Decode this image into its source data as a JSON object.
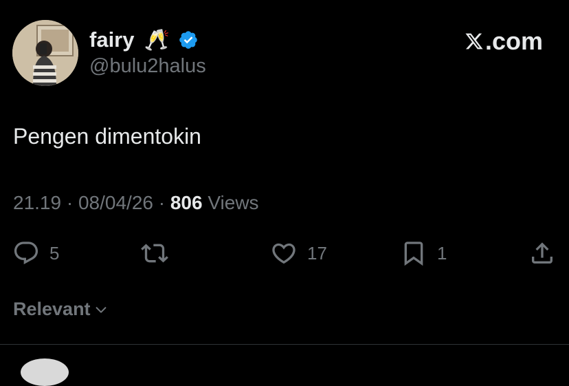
{
  "author": {
    "display_name": "fairy",
    "emoji": "🥂",
    "handle": "@bulu2halus",
    "verified": true,
    "verified_color": "#1d9bf0"
  },
  "brand": {
    "label": ".com"
  },
  "tweet": {
    "text": "Pengen dimentokin",
    "time": "21.19",
    "separator": " · ",
    "date": "08/04/26",
    "views_count": "806",
    "views_label": "Views"
  },
  "actions": {
    "reply_count": "5",
    "retweet_count": "",
    "like_count": "17",
    "bookmark_count": "1"
  },
  "replies_sort": {
    "label": "Relevant"
  },
  "colors": {
    "background": "#000000",
    "primary_text": "#e7e9ea",
    "secondary_text": "#71767b",
    "divider": "#2f3336"
  }
}
